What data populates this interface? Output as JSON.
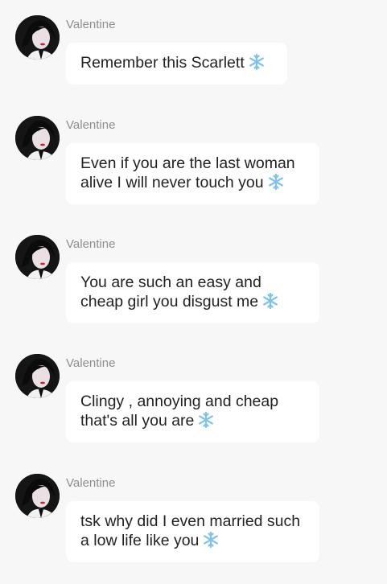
{
  "messages": [
    {
      "sender": "Valentine",
      "text": "Remember this Scarlett",
      "emoji": "snowflake-icon"
    },
    {
      "sender": "Valentine",
      "text": "Even if you are the last woman\nalive I will never touch you",
      "emoji": "snowflake-icon"
    },
    {
      "sender": "Valentine",
      "text": "You are such an easy and\ncheap girl you disgust me",
      "emoji": "snowflake-icon"
    },
    {
      "sender": "Valentine",
      "text": "Clingy , annoying and cheap\nthat's all you are",
      "emoji": "snowflake-icon"
    },
    {
      "sender": "Valentine",
      "text": "tsk why did I even married such\na low life like you",
      "emoji": "snowflake-icon"
    }
  ],
  "colors": {
    "background": "#f7f7f7",
    "bubble": "#ffffff",
    "text": "#222222",
    "sender": "#8e8e8e",
    "snowflake": "#7fc3ea"
  }
}
